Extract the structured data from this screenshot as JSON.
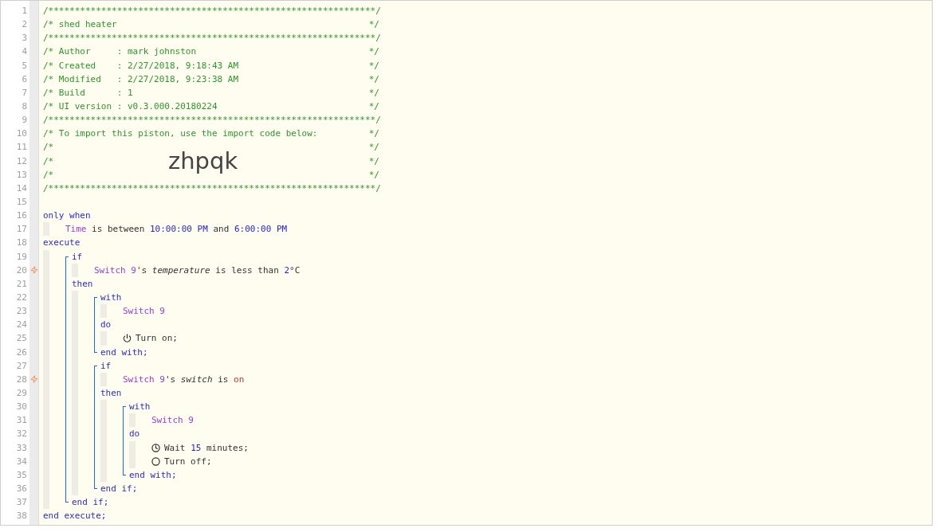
{
  "line_numbers": [
    {
      "number": "1",
      "trigger": false
    },
    {
      "number": "2",
      "trigger": false
    },
    {
      "number": "3",
      "trigger": false
    },
    {
      "number": "4",
      "trigger": false
    },
    {
      "number": "5",
      "trigger": false
    },
    {
      "number": "6",
      "trigger": false
    },
    {
      "number": "7",
      "trigger": false
    },
    {
      "number": "8",
      "trigger": false
    },
    {
      "number": "9",
      "trigger": false
    },
    {
      "number": "10",
      "trigger": false
    },
    {
      "number": "11",
      "trigger": false
    },
    {
      "number": "12",
      "trigger": false
    },
    {
      "number": "13",
      "trigger": false
    },
    {
      "number": "14",
      "trigger": false
    },
    {
      "number": "15",
      "trigger": false
    },
    {
      "number": "16",
      "trigger": false
    },
    {
      "number": "17",
      "trigger": false
    },
    {
      "number": "18",
      "trigger": false
    },
    {
      "number": "19",
      "trigger": false
    },
    {
      "number": "20",
      "trigger": true
    },
    {
      "number": "21",
      "trigger": false
    },
    {
      "number": "22",
      "trigger": false
    },
    {
      "number": "23",
      "trigger": false
    },
    {
      "number": "24",
      "trigger": false
    },
    {
      "number": "25",
      "trigger": false
    },
    {
      "number": "26",
      "trigger": false
    },
    {
      "number": "27",
      "trigger": false
    },
    {
      "number": "28",
      "trigger": true
    },
    {
      "number": "29",
      "trigger": false
    },
    {
      "number": "30",
      "trigger": false
    },
    {
      "number": "31",
      "trigger": false
    },
    {
      "number": "32",
      "trigger": false
    },
    {
      "number": "33",
      "trigger": false
    },
    {
      "number": "34",
      "trigger": false
    },
    {
      "number": "35",
      "trigger": false
    },
    {
      "number": "36",
      "trigger": false
    },
    {
      "number": "37",
      "trigger": false
    },
    {
      "number": "38",
      "trigger": false
    }
  ],
  "header_comment": [
    {
      "text": "/**************************************************************/"
    },
    {
      "text": "/* shed heater",
      "end": "*/"
    },
    {
      "text": "/**************************************************************/"
    },
    {
      "text": "/* Author     : mark johnston",
      "end": "*/"
    },
    {
      "text": "/* Created    : 2/27/2018, 9:18:43 AM",
      "end": "*/"
    },
    {
      "text": "/* Modified   : 2/27/2018, 9:23:38 AM",
      "end": "*/"
    },
    {
      "text": "/* Build      : 1",
      "end": "*/"
    },
    {
      "text": "/* UI version : v0.3.000.20180224",
      "end": "*/"
    },
    {
      "text": "/**************************************************************/"
    },
    {
      "text": "/* To import this piston, use the import code below:",
      "end": "*/"
    },
    {
      "text": "/*",
      "end": "*/"
    },
    {
      "text": "/*",
      "end": "*/"
    },
    {
      "text": "/*",
      "end": "*/"
    },
    {
      "text": "/**************************************************************/"
    }
  ],
  "import_code": "zhpqk",
  "script": [
    {
      "kind": "only_when",
      "keyword": "only when",
      "conditions": [
        [
          {
            "kind": "device",
            "text": "Time"
          },
          {
            "kind": "plain",
            "text": " is between "
          },
          {
            "kind": "value",
            "text": "10:00:00 PM"
          },
          {
            "kind": "plain",
            "text": " and "
          },
          {
            "kind": "value",
            "text": "6:00:00 PM"
          }
        ]
      ]
    },
    {
      "kind": "execute",
      "keyword": "execute",
      "end": "end execute;",
      "body": [
        {
          "kind": "if",
          "keyword": "if",
          "conditions": [
            [
              {
                "kind": "device",
                "text": "Switch 9"
              },
              {
                "kind": "plain",
                "text": "'s "
              },
              {
                "kind": "attribute",
                "text": "temperature"
              },
              {
                "kind": "plain",
                "text": " is less than "
              },
              {
                "kind": "value",
                "text": "2"
              },
              {
                "kind": "plain",
                "text": "°C"
              }
            ]
          ],
          "then": "then",
          "end": "end if;",
          "body": [
            {
              "kind": "with",
              "keyword": "with",
              "devices": [
                [
                  {
                    "kind": "device",
                    "text": "Switch 9"
                  }
                ]
              ],
              "do": "do",
              "end": "end with;",
              "body": [
                {
                  "kind": "turn_on",
                  "segments": [
                    {
                      "kind": "plain",
                      "text": "Turn on;"
                    }
                  ]
                }
              ]
            },
            {
              "kind": "if",
              "keyword": "if",
              "conditions": [
                [
                  {
                    "kind": "device",
                    "text": "Switch 9"
                  },
                  {
                    "kind": "plain",
                    "text": "'s "
                  },
                  {
                    "kind": "attribute",
                    "text": "switch"
                  },
                  {
                    "kind": "plain",
                    "text": " is "
                  },
                  {
                    "kind": "state",
                    "text": "on"
                  }
                ]
              ],
              "then": "then",
              "end": "end if;",
              "body": [
                {
                  "kind": "with",
                  "keyword": "with",
                  "devices": [
                    [
                      {
                        "kind": "device",
                        "text": "Switch 9"
                      }
                    ]
                  ],
                  "do": "do",
                  "end": "end with;",
                  "body": [
                    {
                      "kind": "wait",
                      "segments": [
                        {
                          "kind": "plain",
                          "text": "Wait "
                        },
                        {
                          "kind": "value",
                          "text": "15"
                        },
                        {
                          "kind": "plain",
                          "text": " minutes;"
                        }
                      ]
                    },
                    {
                      "kind": "turn_off",
                      "segments": [
                        {
                          "kind": "plain",
                          "text": "Turn off;"
                        }
                      ]
                    }
                  ]
                }
              ]
            }
          ]
        }
      ]
    }
  ]
}
